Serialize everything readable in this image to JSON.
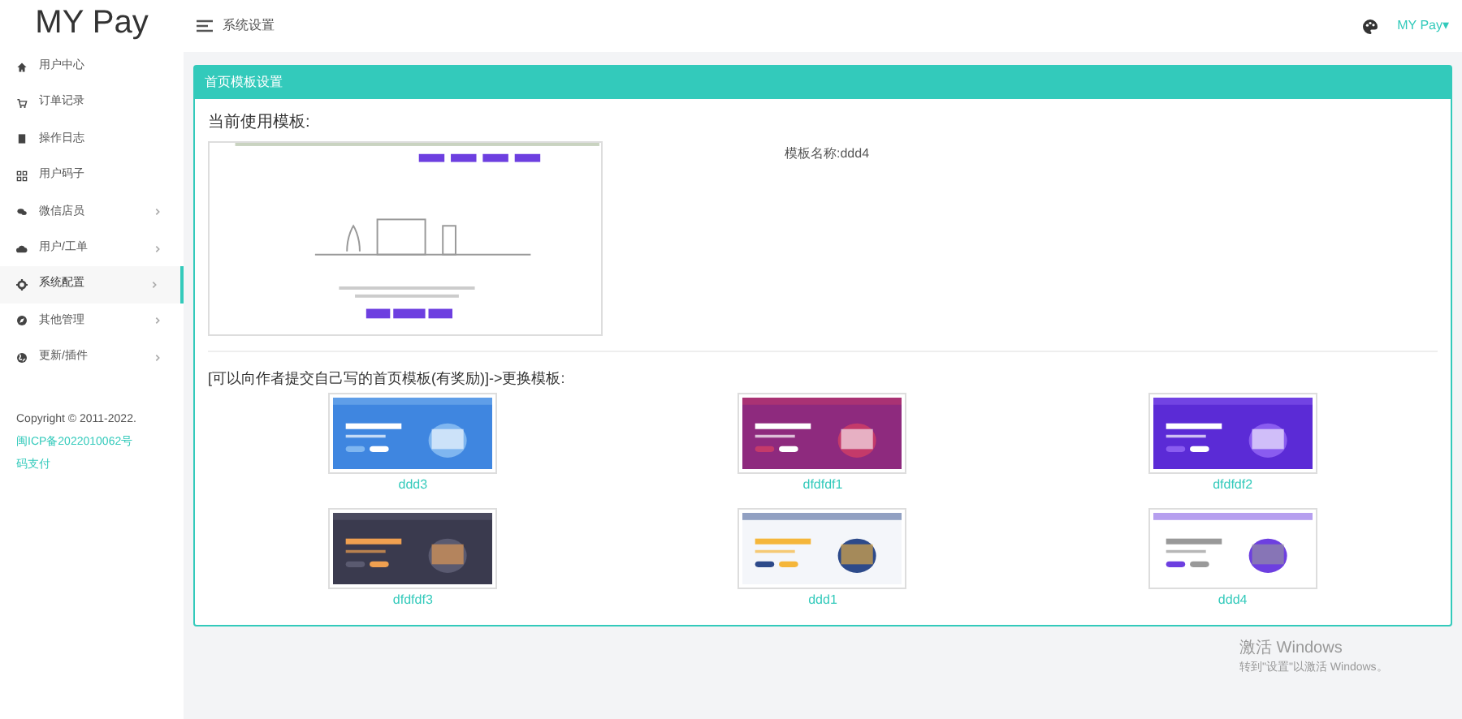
{
  "brand": "MY Pay",
  "sidebar": {
    "items": [
      {
        "label": "用户中心",
        "has_arrow": false,
        "selected": false
      },
      {
        "label": "订单记录",
        "has_arrow": false,
        "selected": false
      },
      {
        "label": "操作日志",
        "has_arrow": false,
        "selected": false
      },
      {
        "label": "用户码子",
        "has_arrow": false,
        "selected": false
      },
      {
        "label": "微信店员",
        "has_arrow": true,
        "selected": false
      },
      {
        "label": "用户/工单",
        "has_arrow": true,
        "selected": false
      },
      {
        "label": "系统配置",
        "has_arrow": true,
        "selected": true
      },
      {
        "label": "其他管理",
        "has_arrow": true,
        "selected": false
      },
      {
        "label": "更新/插件",
        "has_arrow": true,
        "selected": false
      }
    ],
    "copyright": "Copyright © 2011-2022.",
    "icp_link": "闽ICP备2022010062号",
    "site_link": "码支付"
  },
  "topbar": {
    "title": "系统设置",
    "user": "MY Pay▾"
  },
  "panel": {
    "title": "首页模板设置",
    "current_label": "当前使用模板:",
    "template_name_label": "模板名称:",
    "template_name": "ddd4",
    "change_label": "[可以向作者提交自己写的首页模板(有奖励)]->更换模板:",
    "templates": [
      {
        "name": "ddd3"
      },
      {
        "name": "dfdfdf1"
      },
      {
        "name": "dfdfdf2"
      },
      {
        "name": "dfdfdf3"
      },
      {
        "name": "ddd1"
      },
      {
        "name": "ddd4"
      }
    ]
  },
  "os_notice": {
    "title": "激活 Windows",
    "subtitle": "转到\"设置\"以激活 Windows。"
  }
}
